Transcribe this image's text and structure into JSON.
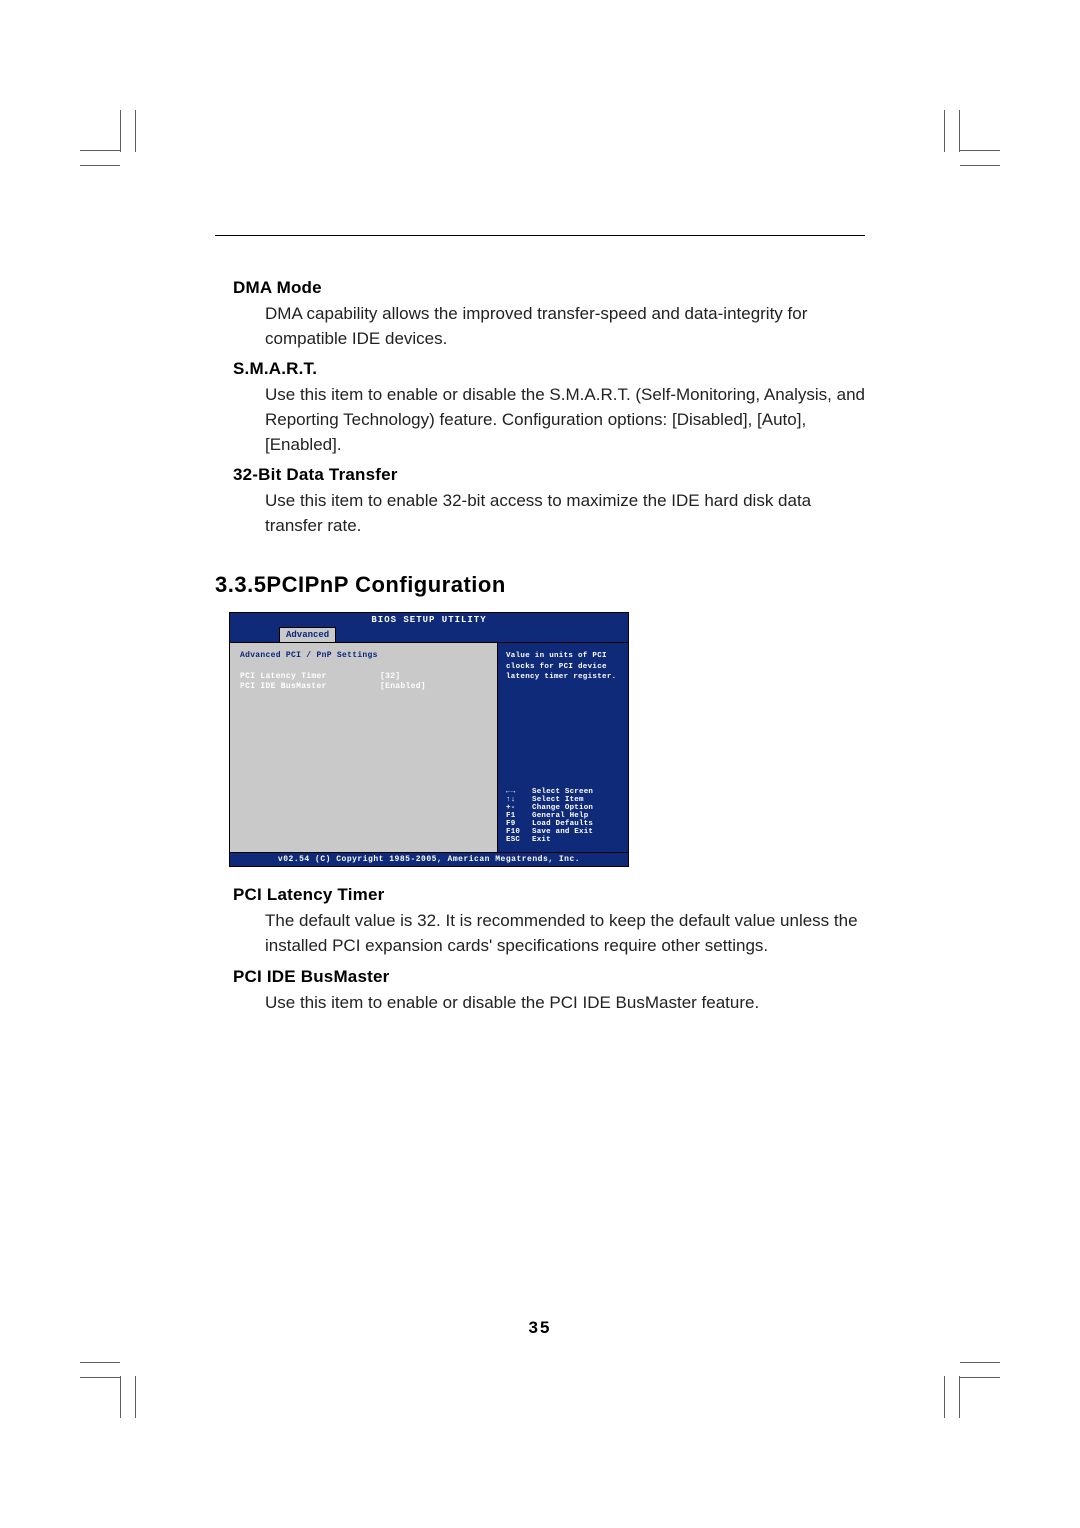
{
  "page_number": "35",
  "sections": {
    "dma_mode": {
      "label": "DMA Mode",
      "body": "DMA capability allows the improved transfer-speed and data-integrity for compatible IDE devices."
    },
    "smart": {
      "label": "S.M.A.R.T.",
      "body": "Use this item to enable or disable the S.M.A.R.T. (Self-Monitoring, Analysis, and Reporting Technology) feature. Configuration options: [Disabled], [Auto], [Enabled]."
    },
    "bit32": {
      "label": "32-Bit Data Transfer",
      "body": "Use this item to enable 32-bit access to maximize the IDE hard disk data transfer rate."
    }
  },
  "heading": "3.3.5PCIPnP Configuration",
  "bios": {
    "title": "BIOS SETUP UTILITY",
    "tab": "Advanced",
    "settings_title": "Advanced PCI / PnP Settings",
    "rows": [
      {
        "k": "PCI Latency Timer",
        "v": "[32]"
      },
      {
        "k": "PCI IDE BusMaster",
        "v": "[Enabled]"
      }
    ],
    "help": "Value in units of PCI clocks for PCI device latency timer register.",
    "nav": [
      {
        "k": "←→",
        "v": "Select Screen"
      },
      {
        "k": "↑↓",
        "v": "Select Item"
      },
      {
        "k": "+-",
        "v": "Change Option"
      },
      {
        "k": "F1",
        "v": "General Help"
      },
      {
        "k": "F9",
        "v": "Load Defaults"
      },
      {
        "k": "F10",
        "v": "Save and Exit"
      },
      {
        "k": "ESC",
        "v": "Exit"
      }
    ],
    "footer": "v02.54 (C) Copyright 1985-2005, American Megatrends, Inc."
  },
  "post_sections": {
    "pci_latency": {
      "label": "PCI Latency Timer",
      "body": "The default value is 32. It is recommended to keep the default value unless the installed PCI expansion cards' specifications require other settings."
    },
    "pci_ide": {
      "label": "PCI IDE BusMaster",
      "body": "Use this item to enable or disable the PCI IDE BusMaster feature."
    }
  }
}
